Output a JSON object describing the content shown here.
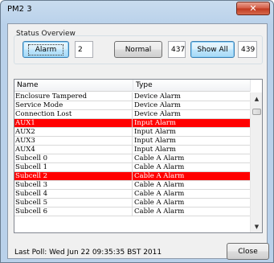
{
  "window": {
    "title": "PM2 3",
    "close_glyph": "✕"
  },
  "status_overview": {
    "label": "Status Overview",
    "alarm_button": "Alarm",
    "alarm_count": "2",
    "normal_button": "Normal",
    "normal_count": "437",
    "show_all_button": "Show All",
    "show_all_count": "439"
  },
  "table": {
    "columns": [
      "Name",
      "Type"
    ],
    "rows": [
      {
        "name": "Enclosure Tampered",
        "type": "Device Alarm",
        "alarm": false
      },
      {
        "name": "Service Mode",
        "type": "Device Alarm",
        "alarm": false
      },
      {
        "name": "Connection Lost",
        "type": "Device Alarm",
        "alarm": false
      },
      {
        "name": "AUX1",
        "type": "Input Alarm",
        "alarm": true
      },
      {
        "name": "AUX2",
        "type": "Input Alarm",
        "alarm": false
      },
      {
        "name": "AUX3",
        "type": "Input Alarm",
        "alarm": false
      },
      {
        "name": "AUX4",
        "type": "Input Alarm",
        "alarm": false
      },
      {
        "name": "Subcell 0",
        "type": "Cable A Alarm",
        "alarm": false
      },
      {
        "name": "Subcell 1",
        "type": "Cable A Alarm",
        "alarm": false
      },
      {
        "name": "Subcell 2",
        "type": "Cable A Alarm",
        "alarm": true
      },
      {
        "name": "Subcell 3",
        "type": "Cable A Alarm",
        "alarm": false
      },
      {
        "name": "Subcell 4",
        "type": "Cable A Alarm",
        "alarm": false
      },
      {
        "name": "Subcell 5",
        "type": "Cable A Alarm",
        "alarm": false
      },
      {
        "name": "Subcell 6",
        "type": "Cable A Alarm",
        "alarm": false
      }
    ],
    "alarm_color": "#ff0000"
  },
  "footer": {
    "last_poll": "Last Poll: Wed Jun 22 09:35:35 BST 2011",
    "close_button": "Close"
  },
  "icons": {
    "scroll_up": "up-arrow-icon",
    "scroll_down": "down-arrow-icon"
  }
}
